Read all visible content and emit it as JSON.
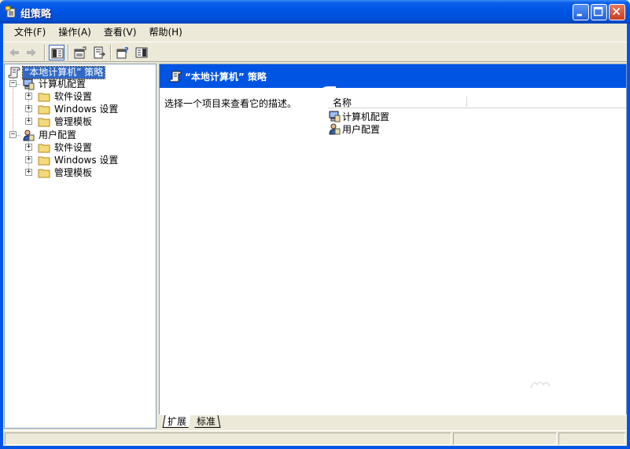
{
  "window": {
    "title": "组策略"
  },
  "menu": [
    {
      "label": "文件(F)"
    },
    {
      "label": "操作(A)"
    },
    {
      "label": "查看(V)"
    },
    {
      "label": "帮助(H)"
    }
  ],
  "toolbar": {
    "buttons": [
      "back-arrow-icon",
      "forward-arrow-icon",
      "show-hide-tree-icon",
      "properties-icon",
      "export-list-icon",
      "help-icon",
      "show-hide-action-pane-icon"
    ]
  },
  "tree": {
    "root": "“本地计算机” 策略",
    "computer_config": "计算机配置",
    "user_config": "用户配置",
    "software_settings": "软件设置",
    "windows_settings": "Windows 设置",
    "admin_templates": "管理模板",
    "expander_expanded": "−",
    "expander_collapsed": "+"
  },
  "content": {
    "header_title": "“本地计算机” 策略",
    "description": "选择一个项目来查看它的描述。",
    "column_name": "名称",
    "items": [
      {
        "label": "计算机配置",
        "icon": "computer-config-icon"
      },
      {
        "label": "用户配置",
        "icon": "user-config-icon"
      }
    ]
  },
  "tabs": {
    "extended": "扩展",
    "standard": "标准"
  },
  "colors": {
    "title_blue": "#0054E3",
    "selection": "#316AC5",
    "window_bg": "#ECE9D8"
  }
}
